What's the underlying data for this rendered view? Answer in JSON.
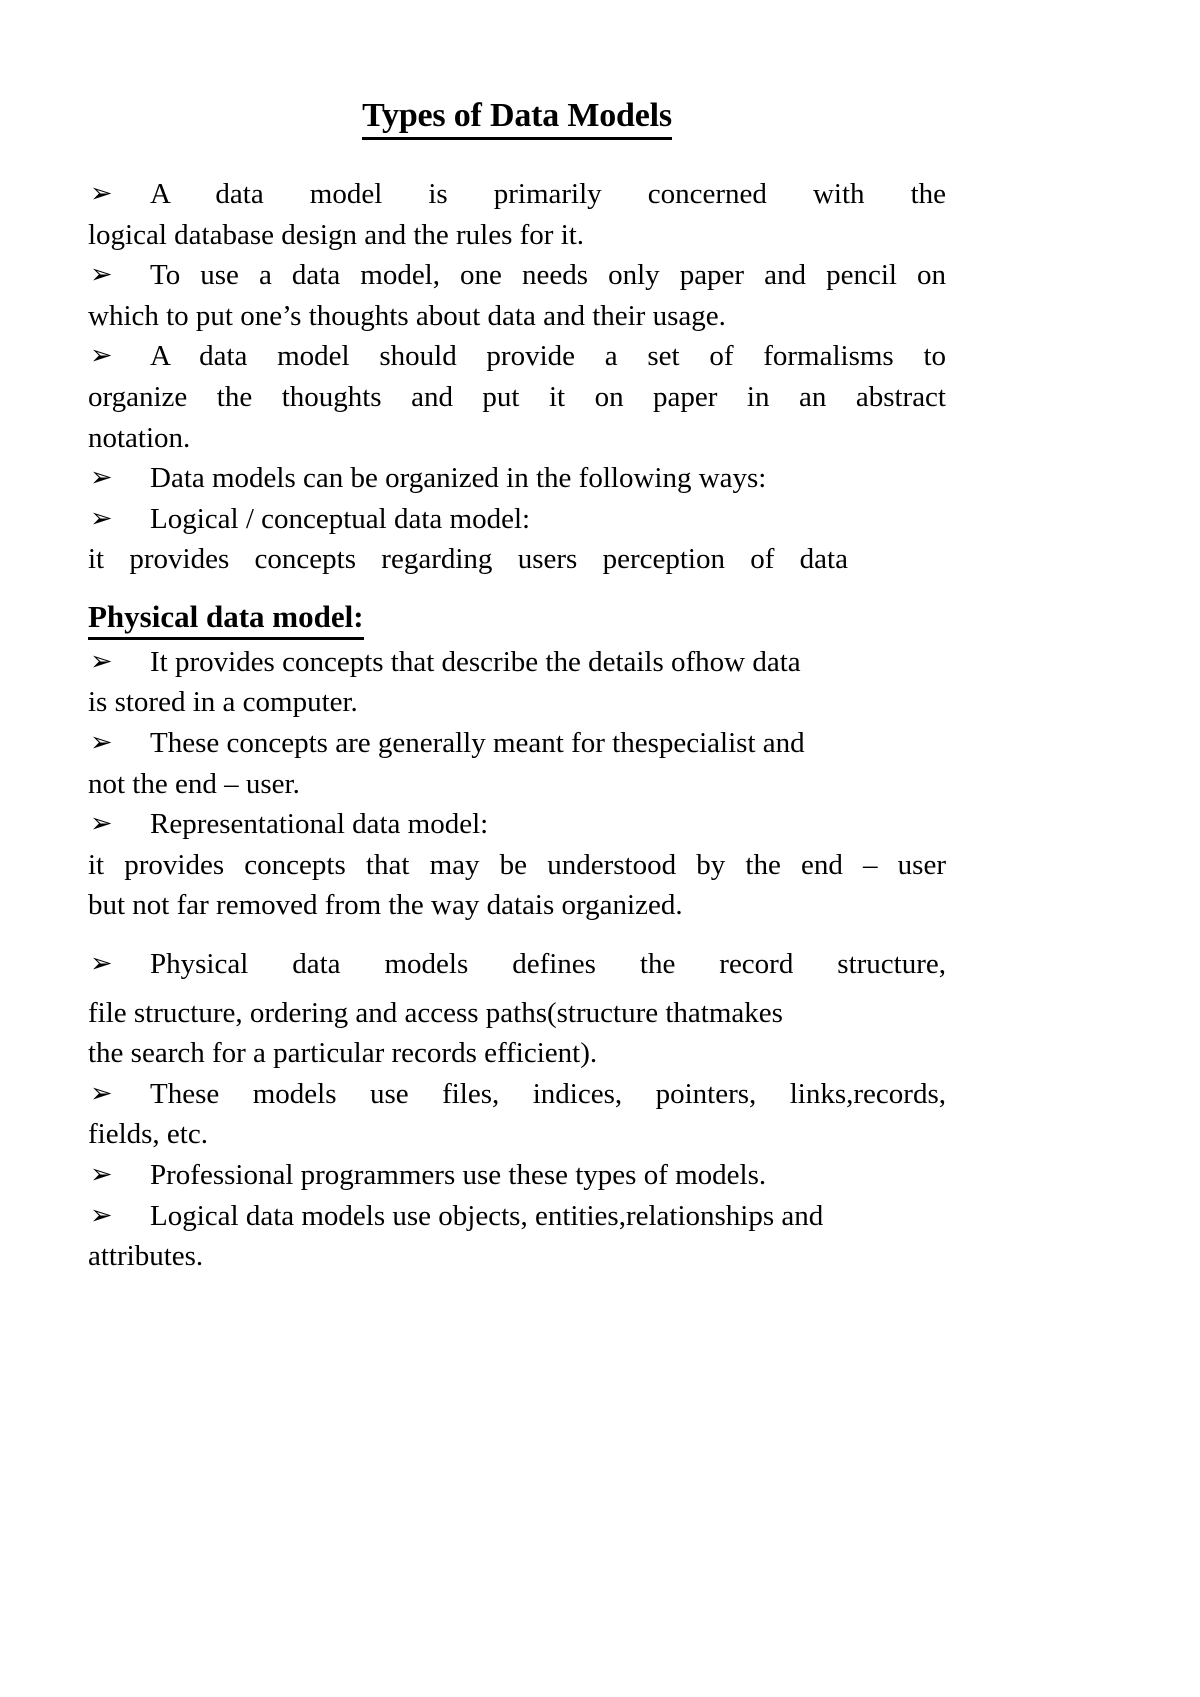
{
  "document": {
    "title": "Types of Data Models",
    "bullet_glyph": "➢",
    "sections": [
      {
        "id": "intro",
        "blocks": [
          {
            "type": "bullet",
            "justified": true,
            "lines": [
              "A data model is primarily concerned with the",
              "logical database design and the rules for it."
            ]
          },
          {
            "type": "bullet",
            "justified": true,
            "lines": [
              "To use a data model, one needs only paper and pencil on",
              "which to put one’s thoughts about data and their usage."
            ]
          },
          {
            "type": "bullet",
            "justified": true,
            "lines": [
              "A data model should provide a set of formalisms to",
              "organize the thoughts and put it on paper in an abstract",
              "notation."
            ]
          },
          {
            "type": "bullet",
            "justified": false,
            "lines": [
              "Data models can be organized in the following ways:"
            ]
          },
          {
            "type": "bullet",
            "justified": false,
            "lines": [
              "Logical / conceptual data model:"
            ]
          },
          {
            "type": "plain",
            "justified": true,
            "lines": [
              "it provides concepts regarding users perception of data"
            ]
          }
        ]
      },
      {
        "id": "physical",
        "heading": "Physical data model:",
        "blocks": [
          {
            "type": "bullet",
            "justified": false,
            "lines": [
              "It provides concepts that describe the details   ofhow data",
              "is stored in a computer."
            ]
          },
          {
            "type": "bullet",
            "justified": false,
            "lines": [
              "These concepts are generally meant for thespecialist and",
              "not the end – user."
            ]
          },
          {
            "type": "bullet",
            "justified": false,
            "lines": [
              "Representational data model:"
            ]
          },
          {
            "type": "plain",
            "justified": false,
            "lines": [
              "it provides concepts that may be understood by the end – user",
              "but not far removed from the way datais organized."
            ]
          },
          {
            "type": "bullet",
            "justified": true,
            "lines": [
              "Physical data models defines the record structure,",
              "file structure, ordering and access paths(structure thatmakes",
              "the search for a particular records efficient)."
            ]
          },
          {
            "type": "bullet",
            "justified": false,
            "lines": [
              "These models use files, indices, pointers, links,records,",
              "fields, etc."
            ]
          },
          {
            "type": "bullet",
            "justified": false,
            "lines": [
              "Professional programmers use these types of models."
            ]
          },
          {
            "type": "bullet",
            "justified": false,
            "lines": [
              "Logical data models use objects, entities,relationships and",
              "attributes."
            ]
          }
        ]
      }
    ]
  }
}
